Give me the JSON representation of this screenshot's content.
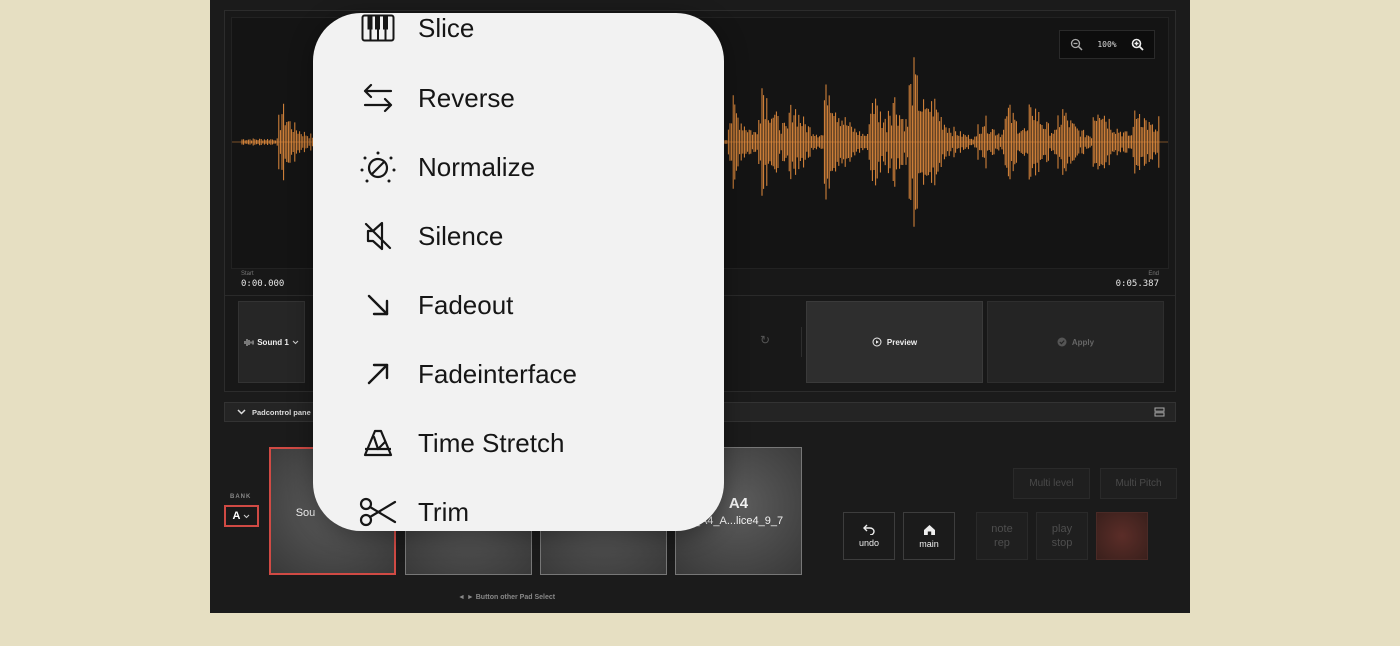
{
  "editor": {
    "zoom_level": "100%",
    "start_label": "Start",
    "start_time": "0:00.000",
    "end_label": "End",
    "end_time": "0:05.387",
    "sound_selector": "Sound 1",
    "preview_label": "Preview",
    "apply_label": "Apply",
    "waveform_color": "#e08a3c"
  },
  "pad_control": {
    "title": "Padcontrol pane"
  },
  "bank": {
    "label": "BANK",
    "value": "A"
  },
  "pads": [
    {
      "name": "",
      "subtitle": "Sou"
    },
    {
      "name": "",
      "subtitle": ""
    },
    {
      "name": "",
      "subtitle": ""
    },
    {
      "name": "A4",
      "subtitle": "_A4_A...lice4_9_7"
    }
  ],
  "pad_hint": "◄ ► Button other Pad Select",
  "controls": {
    "undo": "undo",
    "main": "main",
    "note_rep": "note\nrep",
    "play_stop": "play\nstop",
    "multi_level": "Multi level",
    "multi_pitch": "Multi Pitch"
  },
  "menu": {
    "items": [
      {
        "label": "Slice",
        "icon": "piano-keys-icon"
      },
      {
        "label": "Reverse",
        "icon": "swap-arrows-icon"
      },
      {
        "label": "Normalize",
        "icon": "sun-slash-icon"
      },
      {
        "label": "Silence",
        "icon": "speaker-muted-icon"
      },
      {
        "label": "Fadeout",
        "icon": "arrow-down-right-icon"
      },
      {
        "label": "Fadeinterface",
        "icon": "arrow-up-right-icon"
      },
      {
        "label": "Time Stretch",
        "icon": "metronome-icon"
      },
      {
        "label": "Trim",
        "icon": "scissors-icon"
      }
    ]
  }
}
